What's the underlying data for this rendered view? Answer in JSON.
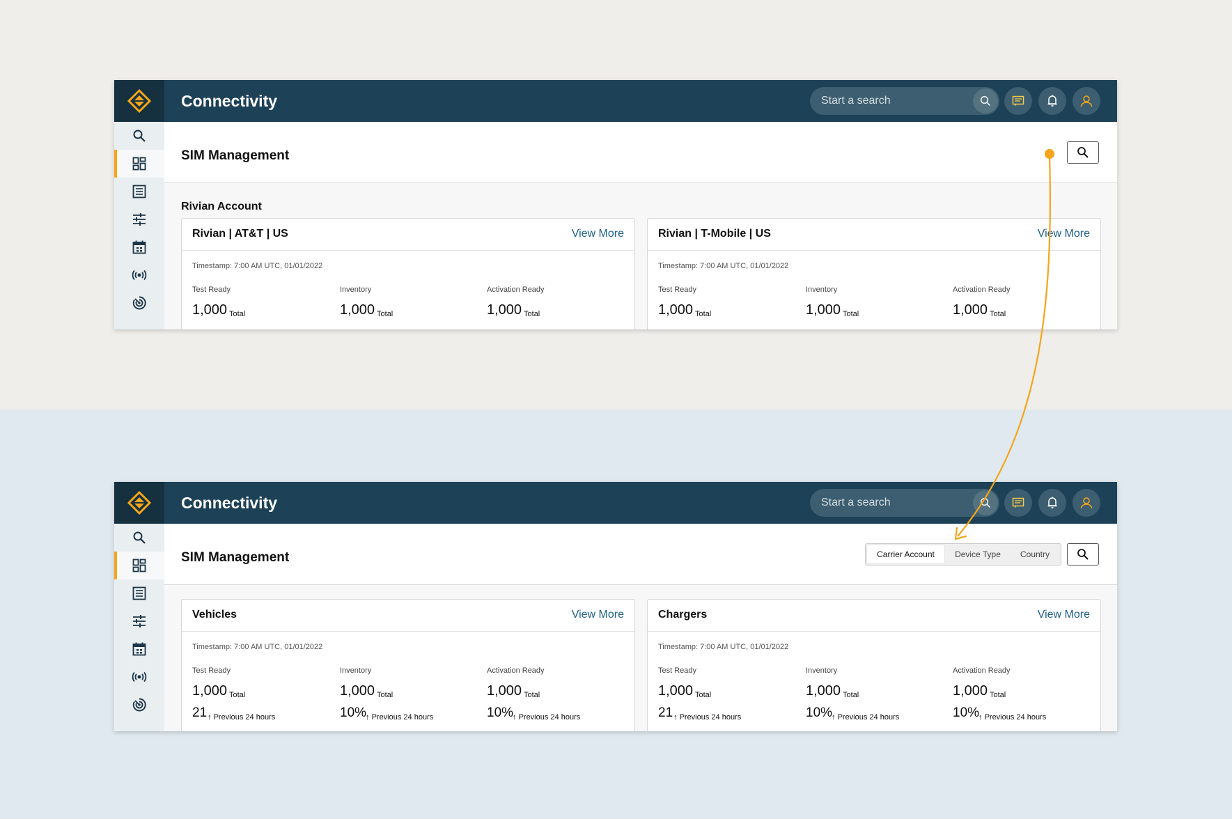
{
  "app": {
    "title": "Connectivity",
    "search_placeholder": "Start a search"
  },
  "page": {
    "title": "SIM Management"
  },
  "screen1": {
    "section_title": "Rivian Account",
    "cards": [
      {
        "title": "Rivian | AT&T | US",
        "view_more": "View More",
        "timestamp": "Timestamp: 7:00 AM UTC, 01/01/2022",
        "metrics": [
          {
            "label": "Test Ready",
            "value": "1,000",
            "unit": "Total"
          },
          {
            "label": "Inventory",
            "value": "1,000",
            "unit": "Total"
          },
          {
            "label": "Activation Ready",
            "value": "1,000",
            "unit": "Total"
          }
        ]
      },
      {
        "title": "Rivian | T-Mobile | US",
        "view_more": "View More",
        "timestamp": "Timestamp: 7:00 AM UTC, 01/01/2022",
        "metrics": [
          {
            "label": "Test Ready",
            "value": "1,000",
            "unit": "Total"
          },
          {
            "label": "Inventory",
            "value": "1,000",
            "unit": "Total"
          },
          {
            "label": "Activation Ready",
            "value": "1,000",
            "unit": "Total"
          }
        ]
      }
    ]
  },
  "screen2": {
    "filter_options": [
      "Carrier Account",
      "Device Type",
      "Country"
    ],
    "active_filter": "Carrier Account",
    "cards": [
      {
        "title": "Vehicles",
        "view_more": "View More",
        "timestamp": "Timestamp: 7:00 AM UTC, 01/01/2022",
        "metrics": [
          {
            "label": "Test Ready",
            "value": "1,000",
            "unit": "Total",
            "delta": "21",
            "delta_note": "Previous 24 hours"
          },
          {
            "label": "Inventory",
            "value": "1,000",
            "unit": "Total",
            "delta": "10%",
            "delta_note": "Previous 24 hours"
          },
          {
            "label": "Activation Ready",
            "value": "1,000",
            "unit": "Total",
            "delta": "10%",
            "delta_note": "Previous 24 hours"
          }
        ]
      },
      {
        "title": "Chargers",
        "view_more": "View More",
        "timestamp": "Timestamp: 7:00 AM UTC, 01/01/2022",
        "metrics": [
          {
            "label": "Test Ready",
            "value": "1,000",
            "unit": "Total",
            "delta": "21",
            "delta_note": "Previous 24 hours"
          },
          {
            "label": "Inventory",
            "value": "1,000",
            "unit": "Total",
            "delta": "10%",
            "delta_note": "Previous 24 hours"
          },
          {
            "label": "Activation Ready",
            "value": "1,000",
            "unit": "Total",
            "delta": "10%",
            "delta_note": "Previous 24 hours"
          }
        ]
      }
    ]
  },
  "sidebar": {
    "items": [
      "search-icon",
      "dashboard-icon",
      "list-icon",
      "sliders-icon",
      "calendar-icon",
      "signal-icon",
      "radar-icon"
    ],
    "active_index": 1
  },
  "colors": {
    "topbar": "#1d4157",
    "accent": "#f5a51b",
    "link": "#1c5f8a",
    "bg_top": "#efeeea",
    "bg_bottom": "#dfe9ef"
  }
}
